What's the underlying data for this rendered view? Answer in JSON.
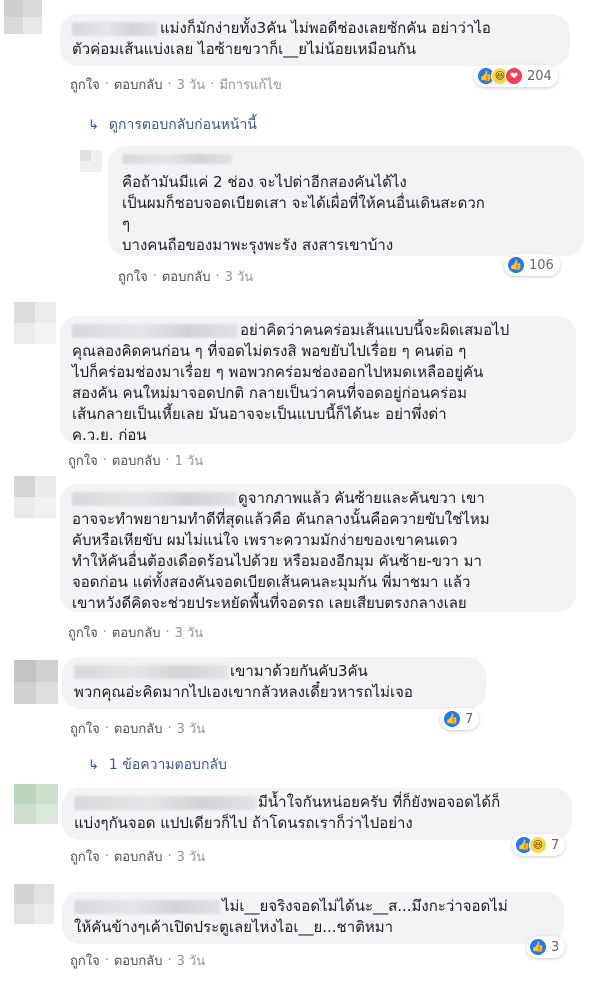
{
  "actions": {
    "like": "ถูกใจ",
    "reply": "ตอบกลับ",
    "separator": "·",
    "edited": "มีการแก้ไข"
  },
  "colors": {
    "bubble": "#f2f3f5",
    "link": "#385898",
    "meta": "#616770",
    "like": "#2078f4"
  },
  "view_previous": "ดูการตอบกลับก่อนหน้านี้",
  "comments": [
    {
      "lines": [
        "แม่งก็มักง่ายทั้ง3คัน ไม่พอดีช่องเลยซักคัน อย่าว่าไอ",
        "ตัวค่อมเส้นแบ่งเลย ไอซ้ายขวาก็เ__ยไม่น้อยเหมือนกัน"
      ],
      "time": "3 วัน",
      "reaction_icons": [
        "like-icon",
        "haha-icon",
        "love-icon"
      ],
      "reaction_count": "204"
    },
    {
      "lines": [
        "คือถ้ามันมีแค่ 2 ช่อง จะไปด่าอีกสองคันได้ไง",
        "เป็นผมก็ชอบจอดเบียดเสา จะได้เผื่อที่ให้คนอื่นเดินสะดวก",
        "ๆ",
        "บางคนถือของมาพะรุงพะรัง สงสารเขาบ้าง"
      ],
      "time": "3 วัน",
      "reaction_icons": [
        "like-icon"
      ],
      "reaction_count": "106"
    },
    {
      "lines": [
        "อย่าคิดว่าคนคร่อมเส้นแบบนี้จะผิดเสมอไป",
        "คุณลองคิดคนก่อน ๆ ที่จอดไม่ตรงสิ พอขยับไปเรื่อย ๆ คนต่อ ๆ",
        "ไปก็คร่อมช่องมาเรื่อย ๆ พอพวกคร่อมช่องออกไปหมดเหลืออยู่คัน",
        "สองคัน คนใหม่มาจอดปกติ กลายเป็นว่าคนที่จอดอยู่ก่อนคร่อม",
        "เส้นกลายเป็นเหี้ยเลย มันอาจจะเป็นแบบนี้ก็ได้นะ อย่าพึ่งด่า",
        "ค.ว.ย. ก่อน"
      ],
      "time": "1 วัน"
    },
    {
      "lines": [
        "ดูจากภาพแล้ว คันซ้ายและคันขวา เขา",
        "อาจจะทำพยายามทำดีที่สุดแล้วคือ คันกลางนั้นคือควายขับใช่ไหม",
        "คับหรือเหียขับ ผมไม่แน่ใจ เพราะความมักง่ายของเขาคนเดว",
        "ทำให้คันอื่นต้องเดือดร้อนไปด้วย หรือมองอีกมุม คันซ้าย-ขวา มา",
        "จอดก่อน แต่ทั้งสองคันจอดเบียดเส้นคนละมุมกัน พี่มาชมา แล้ว",
        "เขาหวังดีคิดจะช่วยประหยัดพื้นที่จอดรถ เลยเสียบตรงกลางเลย"
      ],
      "time": "3 วัน"
    },
    {
      "lines": [
        "เขามาด้วยกันคับ3คัน",
        "พวกคุณอ่ะคิดมากไปเองเขากลัวหลงเดี๋ยวหารถไม่เจอ"
      ],
      "time": "3 วัน",
      "reaction_icons": [
        "like-icon"
      ],
      "reaction_count": "7"
    },
    {
      "lines": [
        "มีน้ำใจกันหน่อยครับ ที่ก็ยังพอจอดได้ก็",
        "แบ่งๆกันจอด แปปเดียวก็ไป ถ้าโดนรถเราก็ว่าไปอย่าง"
      ],
      "time": "3 วัน",
      "reaction_icons": [
        "like-icon",
        "haha-icon"
      ],
      "reaction_count": "7"
    },
    {
      "lines": [
        "ไม่เ__ยจริงจอดไม่ได้นะ__ส...มึงกะว่าจอดไม่",
        "ให้คันข้างๆเค้าเปิดประตูเลยไหงไอเ__ย...ชาติหมา"
      ],
      "time": "3 วัน",
      "reaction_icons": [
        "like-icon"
      ],
      "reaction_count": "3"
    }
  ],
  "more_replies": "1 ข้อความตอบกลับ"
}
